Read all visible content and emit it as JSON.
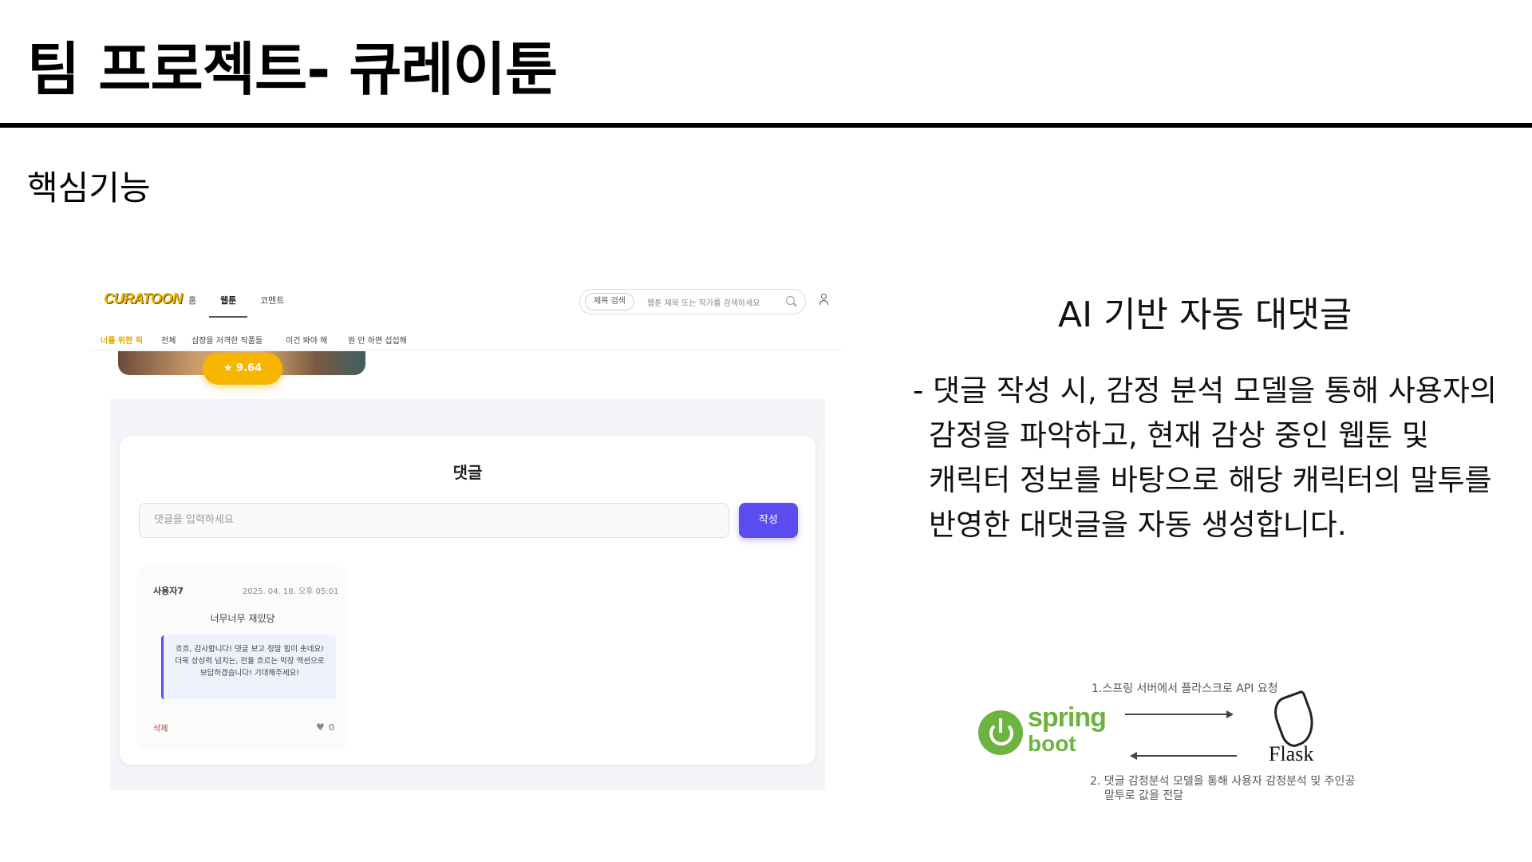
{
  "slide": {
    "title": "팀 프로젝트- 큐레이툰",
    "section": "핵심기능"
  },
  "app": {
    "logo": "CURATOON",
    "nav_tabs": [
      {
        "label": "홈"
      },
      {
        "label": "웹툰"
      },
      {
        "label": "코멘트"
      }
    ],
    "search": {
      "type_label": "제목 검색",
      "placeholder": "웹툰 제목 또는 작가를 검색하세요"
    },
    "subnav": [
      {
        "label": "너를 위한 픽"
      },
      {
        "label": "전체"
      },
      {
        "label": "심장을 저격한 작품들"
      },
      {
        "label": "이건 봐야 해"
      },
      {
        "label": "뭔 안 하면 섭섭해"
      }
    ],
    "rating": "★ 9.64",
    "comments": {
      "heading": "댓글",
      "input_placeholder": "댓글을 입력하세요",
      "submit_label": "작성",
      "items": [
        {
          "author": "사용자7",
          "date": "2025. 04. 18. 오후 05:01",
          "text": "너무너무 재밌당",
          "ai_reply": "흐흐, 감사합니다! 댓글 보고 정말 힘이 솟네요! 더욱 상상력 넘치는, 전율 흐르는 막장 액션으로 보답하겠습니다! 기대해주세요!",
          "delete_label": "삭제",
          "likes": "0"
        }
      ]
    }
  },
  "feature": {
    "title": "AI 기반 자동 대댓글",
    "description_lines": [
      "- 댓글 작성 시, 감정 분석 모델을 통해 사용자의",
      "감정을 파악하고, 현재 감상 중인 웹툰 및",
      "캐릭터 정보를 바탕으로 해당 캐릭터의 말투를",
      "반영한 대댓글을 자동 생성합니다."
    ]
  },
  "architecture": {
    "step1": "1.스프링 서버에서 플라스크로 API 요청",
    "step2_line1": "2. 댓글 감정분석 모델을 통해 사용자 감정분석 및 주인공",
    "step2_line2": "말투로 값을 전달",
    "spring_word": "spring",
    "boot_word": "boot",
    "flask_word": "Flask"
  }
}
